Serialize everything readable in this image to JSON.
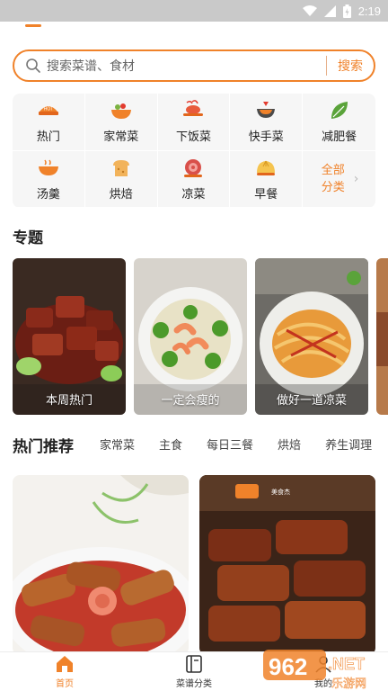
{
  "status_bar": {
    "time": "2:19"
  },
  "search": {
    "placeholder": "搜索菜谱、食材",
    "button_label": "搜索"
  },
  "categories": [
    {
      "label": "热门",
      "icon": "hot-icon"
    },
    {
      "label": "家常菜",
      "icon": "dish-bowl-icon"
    },
    {
      "label": "下饭菜",
      "icon": "shrimp-plate-icon"
    },
    {
      "label": "快手菜",
      "icon": "wok-icon"
    },
    {
      "label": "减肥餐",
      "icon": "leaf-icon"
    },
    {
      "label": "汤羹",
      "icon": "soup-icon"
    },
    {
      "label": "烘焙",
      "icon": "bread-icon"
    },
    {
      "label": "凉菜",
      "icon": "cold-dish-icon"
    },
    {
      "label": "早餐",
      "icon": "bun-icon"
    }
  ],
  "all_categories": {
    "line1": "全部",
    "line2": "分类"
  },
  "topics": {
    "title": "专题",
    "cards": [
      {
        "caption": "本周热门"
      },
      {
        "caption": "一定会瘦的"
      },
      {
        "caption": "做好一道凉菜"
      }
    ]
  },
  "feed": {
    "tabs": [
      "热门推荐",
      "家常菜",
      "主食",
      "每日三餐",
      "烘焙",
      "养生调理"
    ],
    "active_tab": "热门推荐",
    "card_badge": "美食杰"
  },
  "bottom_nav": [
    {
      "label": "首页",
      "icon": "home-icon",
      "active": true
    },
    {
      "label": "菜谱分类",
      "icon": "book-icon",
      "active": false
    },
    {
      "label": "我的",
      "icon": "profile-icon",
      "active": false
    }
  ],
  "watermark": {
    "text1": "962",
    "text2": ".NET",
    "text3": "乐游网"
  },
  "colors": {
    "accent": "#f0822a",
    "grid_bg": "#f6f6f6",
    "status_bar": "#c9c9c9"
  }
}
